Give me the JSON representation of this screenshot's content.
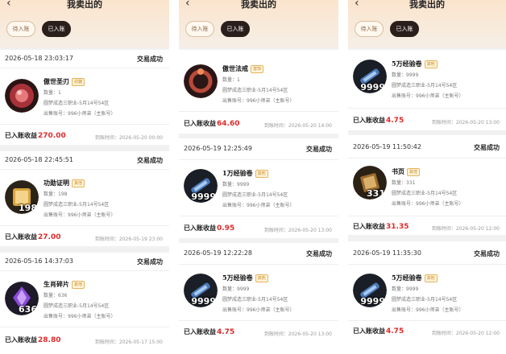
{
  "header": {
    "title": "我卖出的",
    "back_icon": "chevron-left-icon"
  },
  "tabs": {
    "pending": "待入账",
    "active": "已入账"
  },
  "labels": {
    "qty": "数量：",
    "income": "已入账收益",
    "arrival": "到账时间：",
    "sold_by": "出售账号：",
    "status": "交易成功"
  },
  "server": "圆梦成造三职业-5月14号54区",
  "seller": "996小师弟（主账号）",
  "panels": [
    {
      "orders": [
        {
          "datetime": "2026-05-18 23:03:17",
          "name": "傲世圣刃",
          "tag": "武器",
          "qty": "1",
          "overlay": "",
          "amount": "270.00",
          "arrival": "2026-05-20 00:00",
          "icon": "red-orb-icon"
        },
        {
          "datetime": "2026-05-18 22:45:51",
          "name": "功勋证明",
          "tag": "其他",
          "qty": "198",
          "overlay": "198",
          "amount": "27.00",
          "arrival": "2026-05-19 23:00",
          "icon": "scroll-icon"
        },
        {
          "datetime": "2026-05-16 14:37:03",
          "name": "生肖碎片",
          "tag": "其他",
          "qty": "636",
          "overlay": "636",
          "amount": "28.80",
          "arrival": "2026-05-17 15:00",
          "icon": "purple-crystal-icon"
        }
      ]
    },
    {
      "orders": [
        {
          "datetime": "",
          "name": "傲世法戒",
          "tag": "首饰",
          "qty": "1",
          "overlay": "",
          "amount": "64.60",
          "arrival": "2026-05-20 14:00",
          "icon": "ring-icon"
        },
        {
          "datetime": "2026-05-19 12:25:49",
          "name": "1万经验卷",
          "tag": "其他",
          "qty": "9999",
          "overlay": "9999",
          "amount": "0.95",
          "arrival": "2026-05-20 13:00",
          "icon": "exp-scroll-icon"
        },
        {
          "datetime": "2026-05-19 12:22:28",
          "name": "5万经验卷",
          "tag": "其他",
          "qty": "9999",
          "overlay": "9999",
          "amount": "4.75",
          "arrival": "2026-05-20 13:00",
          "icon": "exp-scroll-icon"
        }
      ]
    },
    {
      "orders": [
        {
          "datetime": "",
          "name": "5万经验卷",
          "tag": "其他",
          "qty": "9999",
          "overlay": "9999",
          "amount": "4.75",
          "arrival": "2026-05-20 13:00",
          "icon": "exp-scroll-icon"
        },
        {
          "datetime": "2026-05-19 11:50:42",
          "name": "书页",
          "tag": "其他",
          "qty": "331",
          "overlay": "331",
          "amount": "31.35",
          "arrival": "2026-05-20 12:00",
          "icon": "book-page-icon"
        },
        {
          "datetime": "2026-05-19 11:35:30",
          "name": "5万经验卷",
          "tag": "其他",
          "qty": "9999",
          "overlay": "9999",
          "amount": "4.75",
          "arrival": "2026-05-20 12:00",
          "icon": "exp-scroll-icon"
        }
      ]
    }
  ]
}
